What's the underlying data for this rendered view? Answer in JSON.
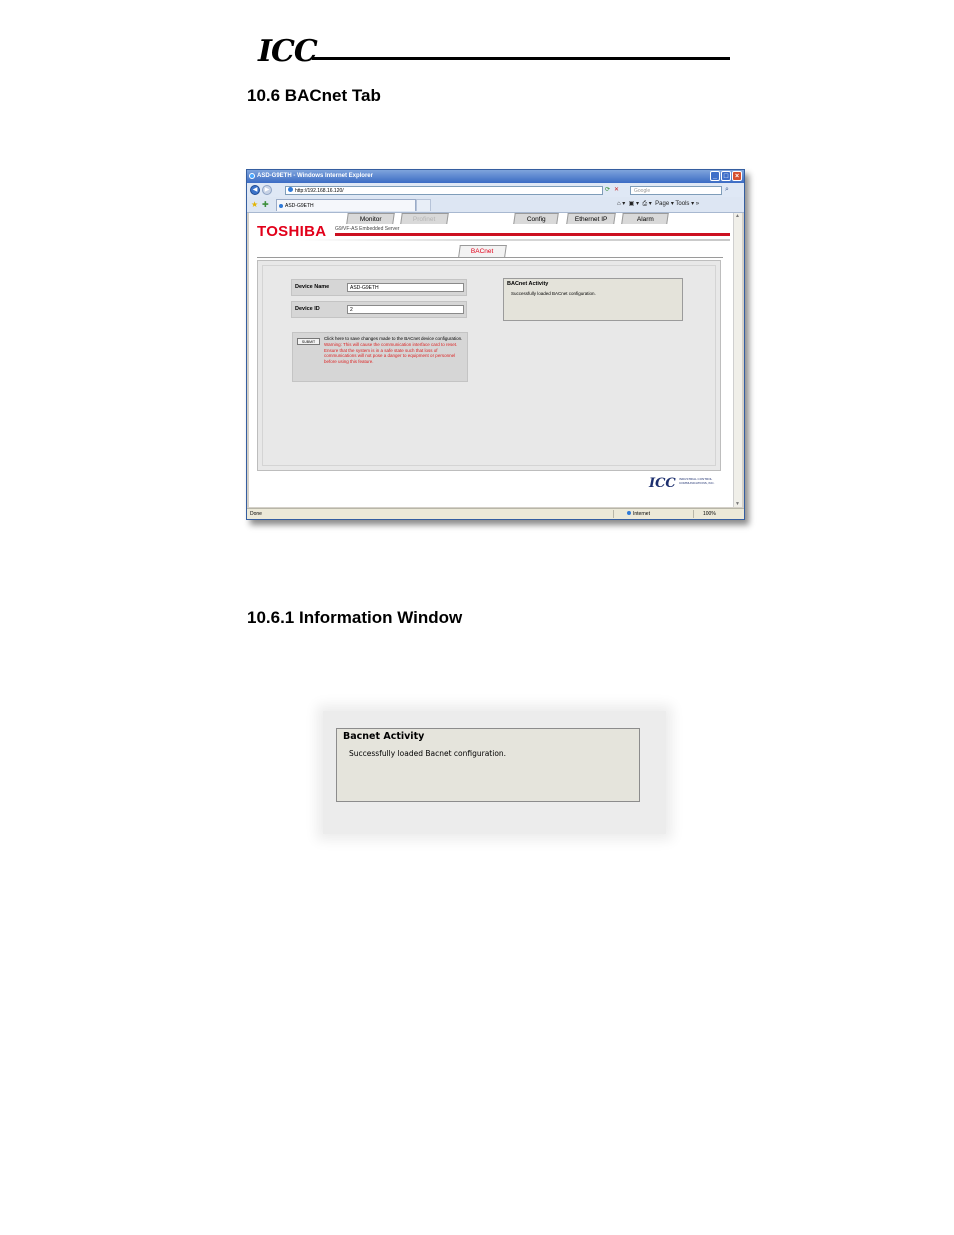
{
  "doc_header": {
    "logo": "ICC"
  },
  "section": {
    "title": "10.6  BACnet Tab"
  },
  "subsection": {
    "title": "10.6.1  Information Window"
  },
  "browser": {
    "window_title": "ASD-G9ETH - Windows Internet Explorer",
    "url": "http://192.168.16.120/",
    "search_placeholder": "Google",
    "tab_title": "ASD-G9ETH",
    "command_bar": "Page ▾  Tools ▾",
    "status_left": "Done",
    "status_zone": "Internet",
    "status_zoom": "100%"
  },
  "app": {
    "brand": "TOSHIBA",
    "server_title": "G9/VF-AS Embedded Server",
    "tabs": [
      {
        "label": "Monitor",
        "state": "normal"
      },
      {
        "label": "Profinet",
        "state": "disabled"
      },
      {
        "label": "BACnet",
        "state": "active"
      },
      {
        "label": "Config",
        "state": "normal"
      },
      {
        "label": "Ethernet IP",
        "state": "normal"
      },
      {
        "label": "Alarm",
        "state": "normal"
      }
    ],
    "device_name_label": "Device Name",
    "device_name_value": "ASD-G9ETH",
    "device_id_label": "Device ID",
    "device_id_value": "2",
    "submit_label": "SUBMIT",
    "submit_info": "Click here to save changes made to the BACnet device configuration.",
    "submit_warning": "Warning: This will cause the communication interface card to reset. Ensure that the system is in a safe state such that loss of communications will not pose a danger to equipment or personnel before using this feature.",
    "activity_title": "BACnet Activity",
    "activity_message": "Successfully loaded BACnet configuration.",
    "footer_logo": "ICC",
    "footer_company": "INDUSTRIAL CONTROL COMMUNICATIONS, INC."
  },
  "info_window": {
    "title": "Bacnet Activity",
    "message": "Successfully loaded Bacnet configuration."
  },
  "colors": {
    "toshiba_red": "#e2001a",
    "warning_red": "#dd2222",
    "panel_gray": "#e8e8e8"
  }
}
